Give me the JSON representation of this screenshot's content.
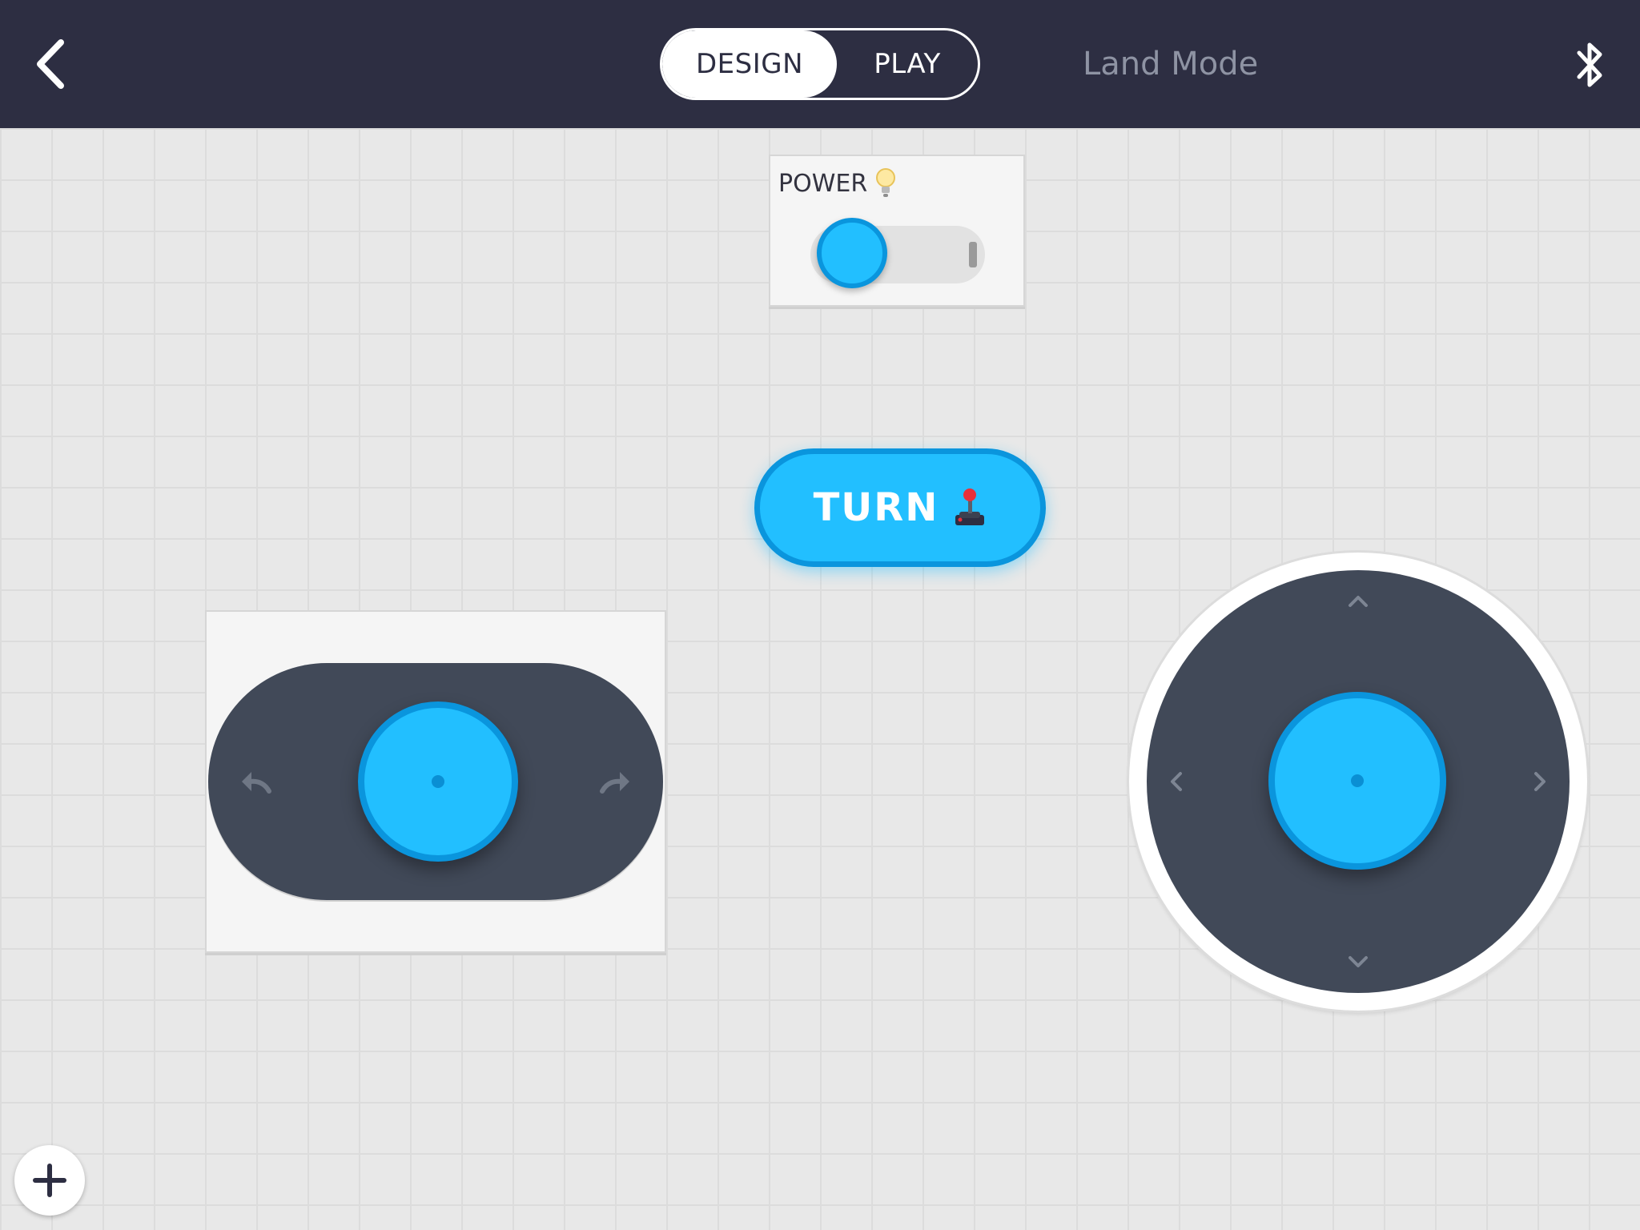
{
  "header": {
    "tabs": [
      {
        "label": "DESIGN",
        "active": true
      },
      {
        "label": "PLAY",
        "active": false
      }
    ],
    "mode_label": "Land Mode"
  },
  "widgets": {
    "power": {
      "label": "POWER",
      "icon": "lightbulb-icon",
      "on": false
    },
    "turn_button": {
      "label": "TURN",
      "icon": "joystick-emoji-icon"
    },
    "slider": {
      "left_icon": "turn-left-arrow-icon",
      "right_icon": "turn-right-arrow-icon",
      "position": 0.5
    },
    "joystick": {
      "arrows": [
        "up",
        "down",
        "left",
        "right"
      ]
    }
  },
  "colors": {
    "header_bg": "#2d2e42",
    "accent": "#22bfff",
    "accent_dark": "#0a95dd",
    "control_dark": "#414958",
    "canvas_bg": "#e8e8e8"
  }
}
